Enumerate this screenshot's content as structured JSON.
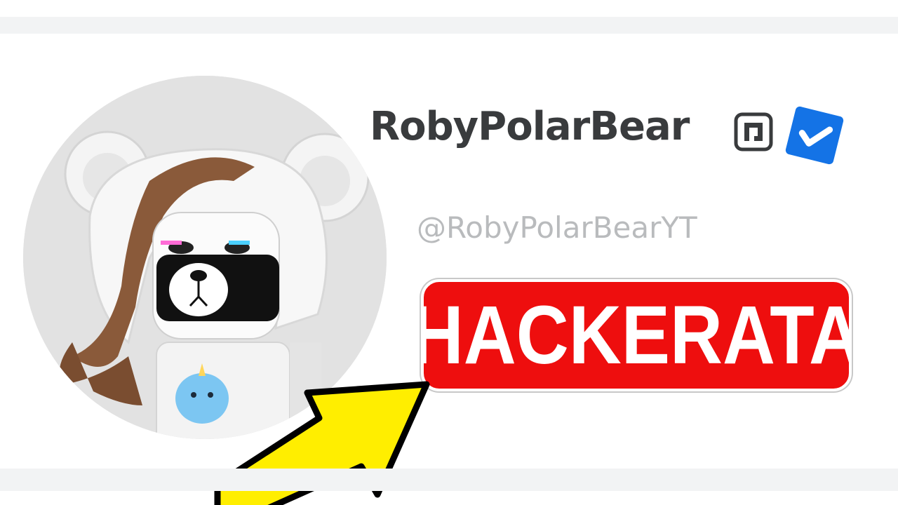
{
  "profile": {
    "display_name": "RobyPolarBear",
    "username": "@RobyPolarBearYT",
    "premium_icon": "roblox-premium-icon",
    "verified_icon": "verified-check-icon",
    "avatar": "polar-bear-avatar"
  },
  "overlay": {
    "label": "HACKERATA",
    "label_color": "#ee0e0e",
    "arrow_icon": "yellow-arrow-icon",
    "arrow_color": "#ffee00"
  },
  "colors": {
    "verified_blue": "#1473e6",
    "name_text": "#393b3d",
    "username_text": "#b9bbbd"
  }
}
